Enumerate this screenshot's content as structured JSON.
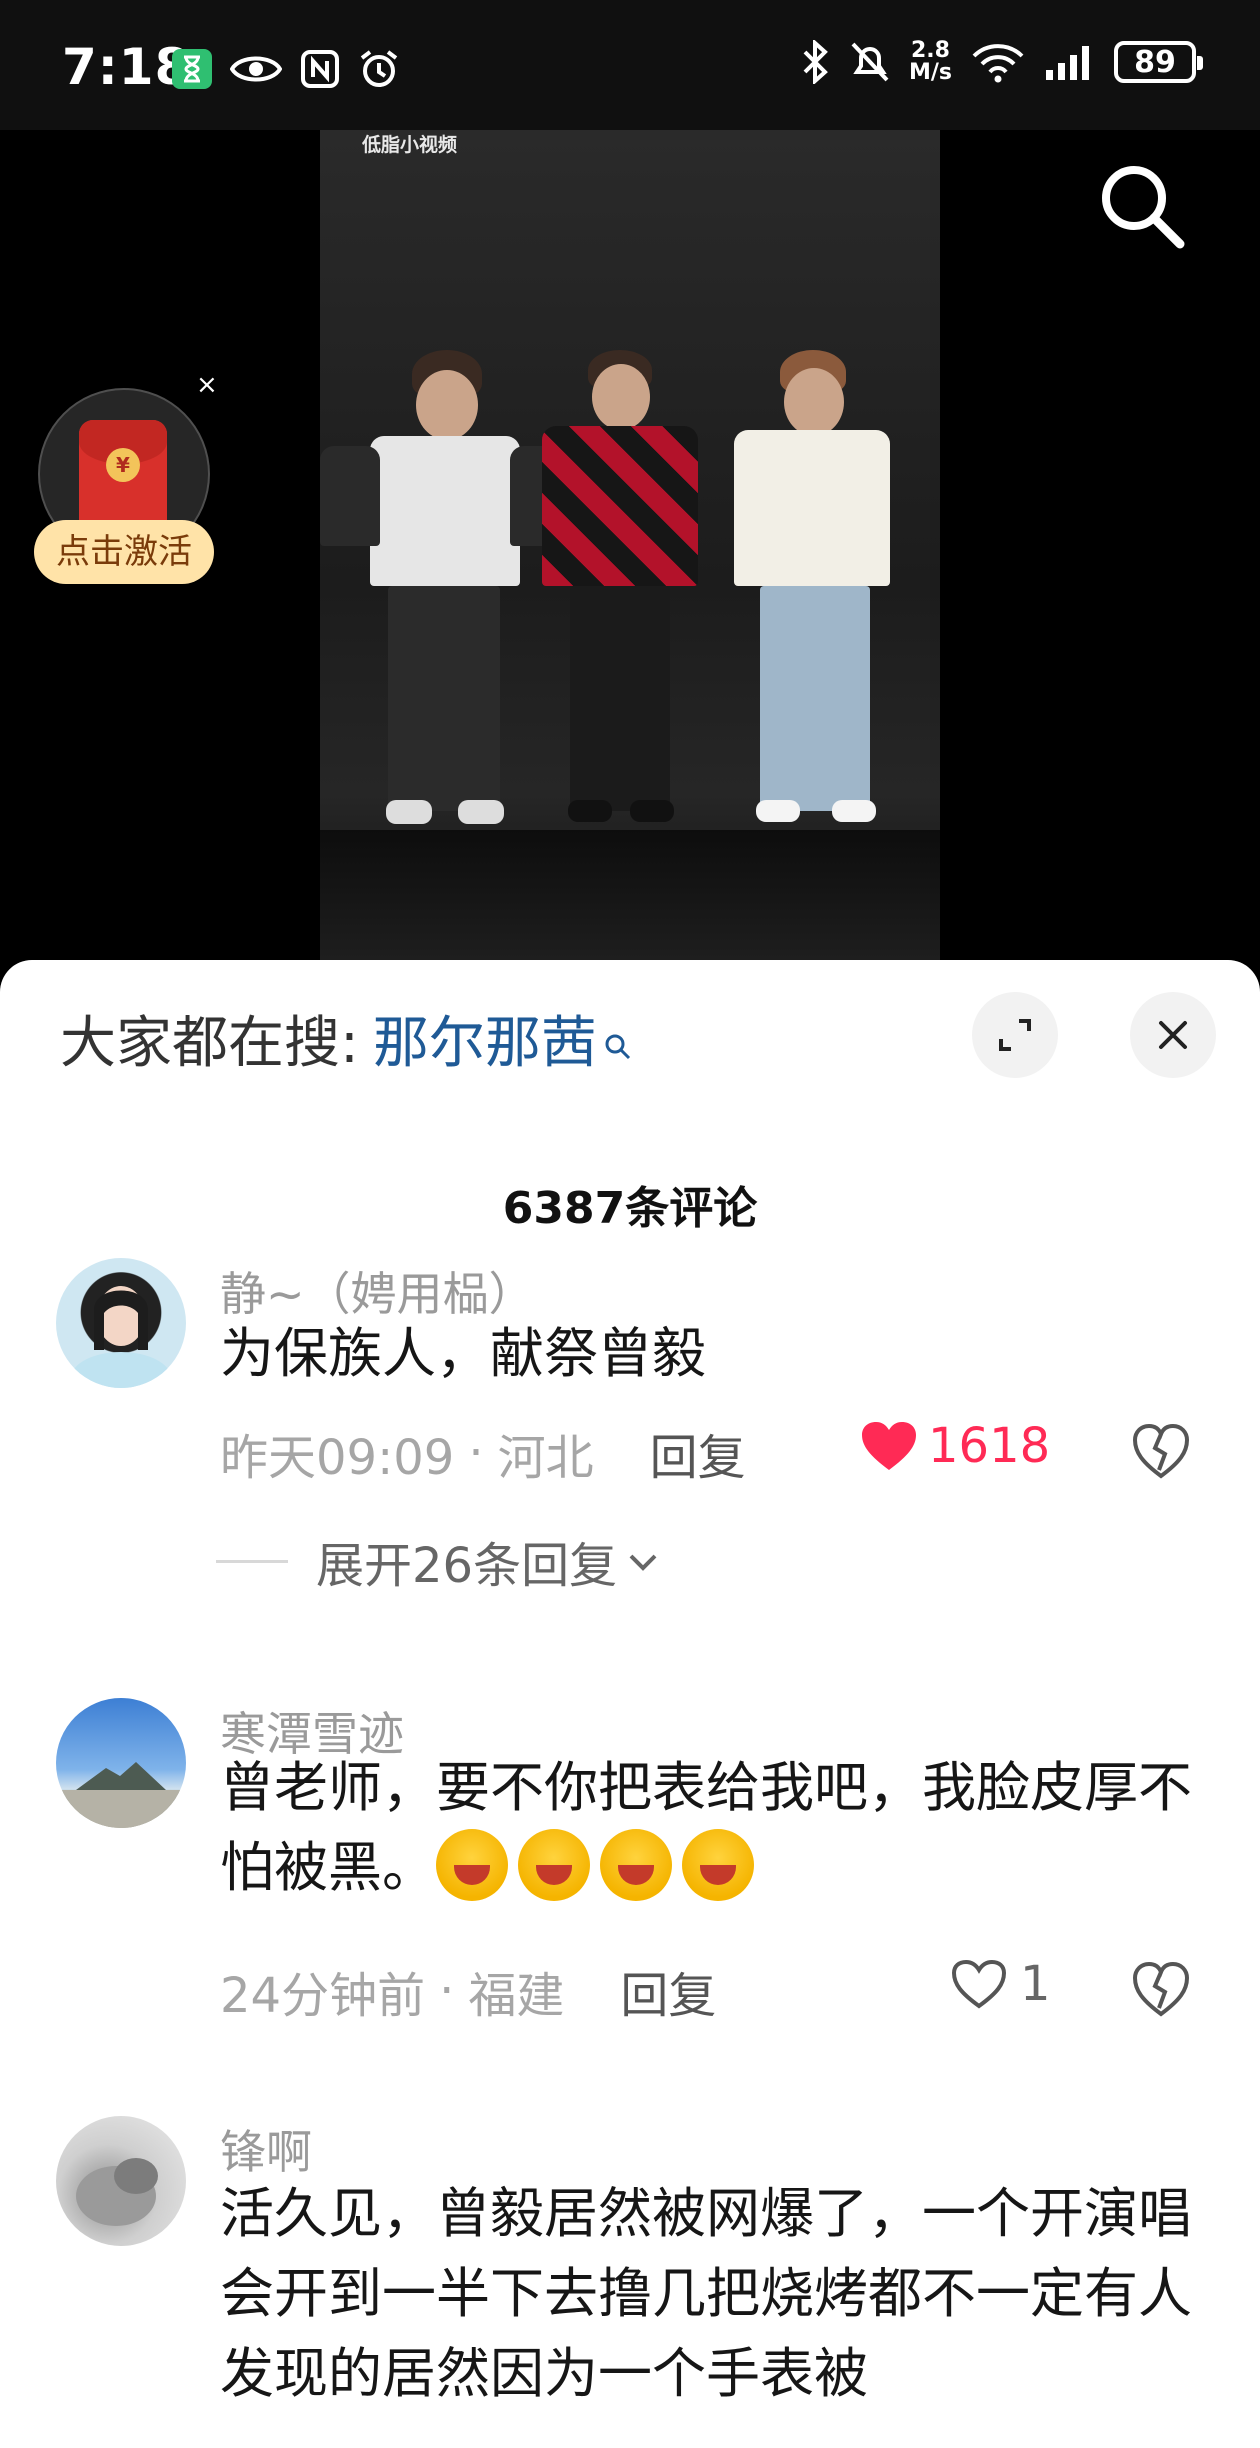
{
  "status_bar": {
    "time": "7:18",
    "net_speed_value": "2.8",
    "net_speed_unit": "M/s",
    "signal_label": "6",
    "battery": "89"
  },
  "video": {
    "watermark": "低脂小视频",
    "red_packet_label": "点击激活",
    "red_packet_coin": "¥",
    "close_label": "×"
  },
  "panel": {
    "hot_search_prefix": "大家都在搜:",
    "hot_search_term": "那尔那茜",
    "comment_count_title": "6387条评论"
  },
  "comments": [
    {
      "user": "静~（娉用榀）",
      "text": "为保族人，献祭曾毅",
      "time": "昨天09:09",
      "location": "河北",
      "reply_label": "回复",
      "likes": "1618",
      "liked": true,
      "expand_label": "展开26条回复"
    },
    {
      "user": "寒潭雪迹",
      "text": "曾老师，要不你把表给我吧，我脸皮厚不怕被黑。",
      "emoji_count": 4,
      "time": "24分钟前",
      "location": "福建",
      "reply_label": "回复",
      "likes": "1",
      "liked": false
    },
    {
      "user": "锋啊",
      "text": "活久见，曾毅居然被网爆了，一个开演唱会开到一半下去撸几把烧烤都不一定有人发现的居然因为一个手表被"
    }
  ],
  "colors": {
    "like_red": "#ff2a55",
    "link_blue": "#1f5a96",
    "panel_bg": "#ffffff"
  }
}
